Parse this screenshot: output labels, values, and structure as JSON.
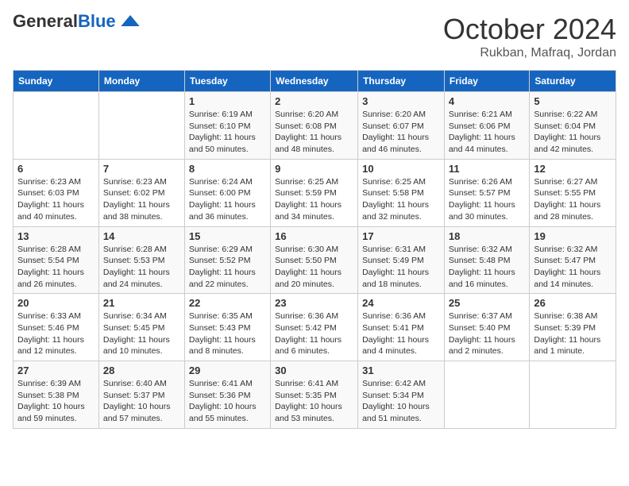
{
  "header": {
    "logo_general": "General",
    "logo_blue": "Blue",
    "month": "October 2024",
    "location": "Rukban, Mafraq, Jordan"
  },
  "weekdays": [
    "Sunday",
    "Monday",
    "Tuesday",
    "Wednesday",
    "Thursday",
    "Friday",
    "Saturday"
  ],
  "weeks": [
    [
      {
        "day": "",
        "info": ""
      },
      {
        "day": "",
        "info": ""
      },
      {
        "day": "1",
        "info": "Sunrise: 6:19 AM\nSunset: 6:10 PM\nDaylight: 11 hours and 50 minutes."
      },
      {
        "day": "2",
        "info": "Sunrise: 6:20 AM\nSunset: 6:08 PM\nDaylight: 11 hours and 48 minutes."
      },
      {
        "day": "3",
        "info": "Sunrise: 6:20 AM\nSunset: 6:07 PM\nDaylight: 11 hours and 46 minutes."
      },
      {
        "day": "4",
        "info": "Sunrise: 6:21 AM\nSunset: 6:06 PM\nDaylight: 11 hours and 44 minutes."
      },
      {
        "day": "5",
        "info": "Sunrise: 6:22 AM\nSunset: 6:04 PM\nDaylight: 11 hours and 42 minutes."
      }
    ],
    [
      {
        "day": "6",
        "info": "Sunrise: 6:23 AM\nSunset: 6:03 PM\nDaylight: 11 hours and 40 minutes."
      },
      {
        "day": "7",
        "info": "Sunrise: 6:23 AM\nSunset: 6:02 PM\nDaylight: 11 hours and 38 minutes."
      },
      {
        "day": "8",
        "info": "Sunrise: 6:24 AM\nSunset: 6:00 PM\nDaylight: 11 hours and 36 minutes."
      },
      {
        "day": "9",
        "info": "Sunrise: 6:25 AM\nSunset: 5:59 PM\nDaylight: 11 hours and 34 minutes."
      },
      {
        "day": "10",
        "info": "Sunrise: 6:25 AM\nSunset: 5:58 PM\nDaylight: 11 hours and 32 minutes."
      },
      {
        "day": "11",
        "info": "Sunrise: 6:26 AM\nSunset: 5:57 PM\nDaylight: 11 hours and 30 minutes."
      },
      {
        "day": "12",
        "info": "Sunrise: 6:27 AM\nSunset: 5:55 PM\nDaylight: 11 hours and 28 minutes."
      }
    ],
    [
      {
        "day": "13",
        "info": "Sunrise: 6:28 AM\nSunset: 5:54 PM\nDaylight: 11 hours and 26 minutes."
      },
      {
        "day": "14",
        "info": "Sunrise: 6:28 AM\nSunset: 5:53 PM\nDaylight: 11 hours and 24 minutes."
      },
      {
        "day": "15",
        "info": "Sunrise: 6:29 AM\nSunset: 5:52 PM\nDaylight: 11 hours and 22 minutes."
      },
      {
        "day": "16",
        "info": "Sunrise: 6:30 AM\nSunset: 5:50 PM\nDaylight: 11 hours and 20 minutes."
      },
      {
        "day": "17",
        "info": "Sunrise: 6:31 AM\nSunset: 5:49 PM\nDaylight: 11 hours and 18 minutes."
      },
      {
        "day": "18",
        "info": "Sunrise: 6:32 AM\nSunset: 5:48 PM\nDaylight: 11 hours and 16 minutes."
      },
      {
        "day": "19",
        "info": "Sunrise: 6:32 AM\nSunset: 5:47 PM\nDaylight: 11 hours and 14 minutes."
      }
    ],
    [
      {
        "day": "20",
        "info": "Sunrise: 6:33 AM\nSunset: 5:46 PM\nDaylight: 11 hours and 12 minutes."
      },
      {
        "day": "21",
        "info": "Sunrise: 6:34 AM\nSunset: 5:45 PM\nDaylight: 11 hours and 10 minutes."
      },
      {
        "day": "22",
        "info": "Sunrise: 6:35 AM\nSunset: 5:43 PM\nDaylight: 11 hours and 8 minutes."
      },
      {
        "day": "23",
        "info": "Sunrise: 6:36 AM\nSunset: 5:42 PM\nDaylight: 11 hours and 6 minutes."
      },
      {
        "day": "24",
        "info": "Sunrise: 6:36 AM\nSunset: 5:41 PM\nDaylight: 11 hours and 4 minutes."
      },
      {
        "day": "25",
        "info": "Sunrise: 6:37 AM\nSunset: 5:40 PM\nDaylight: 11 hours and 2 minutes."
      },
      {
        "day": "26",
        "info": "Sunrise: 6:38 AM\nSunset: 5:39 PM\nDaylight: 11 hours and 1 minute."
      }
    ],
    [
      {
        "day": "27",
        "info": "Sunrise: 6:39 AM\nSunset: 5:38 PM\nDaylight: 10 hours and 59 minutes."
      },
      {
        "day": "28",
        "info": "Sunrise: 6:40 AM\nSunset: 5:37 PM\nDaylight: 10 hours and 57 minutes."
      },
      {
        "day": "29",
        "info": "Sunrise: 6:41 AM\nSunset: 5:36 PM\nDaylight: 10 hours and 55 minutes."
      },
      {
        "day": "30",
        "info": "Sunrise: 6:41 AM\nSunset: 5:35 PM\nDaylight: 10 hours and 53 minutes."
      },
      {
        "day": "31",
        "info": "Sunrise: 6:42 AM\nSunset: 5:34 PM\nDaylight: 10 hours and 51 minutes."
      },
      {
        "day": "",
        "info": ""
      },
      {
        "day": "",
        "info": ""
      }
    ]
  ]
}
